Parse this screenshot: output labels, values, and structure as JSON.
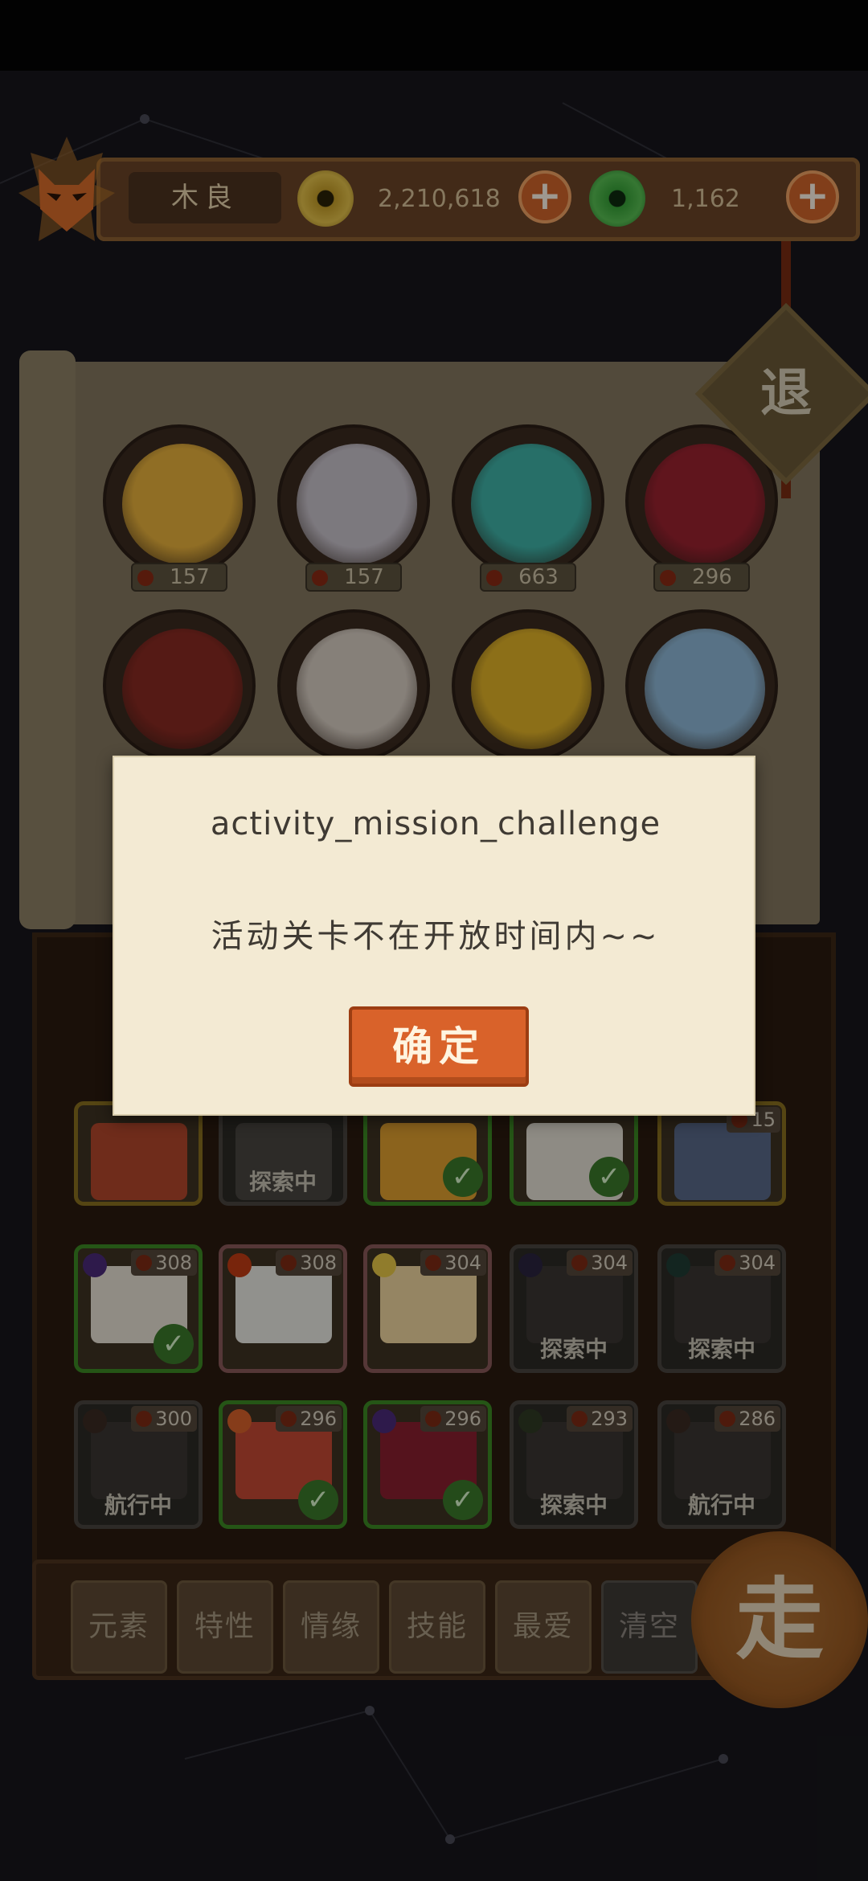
{
  "header": {
    "player_name": "木良",
    "gold_amount": "2,210,618",
    "jade_amount": "1,162",
    "plus_symbol": "+"
  },
  "retreat_label": "退",
  "portraits": [
    {
      "score": "157",
      "color": "#e9b23c"
    },
    {
      "score": "157",
      "color": "#c9c3cc"
    },
    {
      "score": "663",
      "color": "#3fb3a8"
    },
    {
      "score": "296",
      "color": "#9c2230"
    },
    {
      "score": "",
      "color": "#8a2a22"
    },
    {
      "score": "",
      "color": "#d9cfc4"
    },
    {
      "score": "",
      "color": "#e3b428"
    },
    {
      "score": "",
      "color": "#8fb9d8"
    }
  ],
  "cards": [
    {
      "pts": "",
      "status": "",
      "check": false,
      "style": "gold",
      "art": "#b4472c",
      "elem": ""
    },
    {
      "pts": "",
      "status": "探索中",
      "check": false,
      "style": "gray",
      "art": "#4a4642",
      "elem": ""
    },
    {
      "pts": "",
      "status": "",
      "check": true,
      "style": "green",
      "art": "#e0a030",
      "elem": ""
    },
    {
      "pts": "",
      "status": "",
      "check": true,
      "style": "green",
      "art": "#e6e1d6",
      "elem": ""
    },
    {
      "pts": "15",
      "status": "",
      "check": false,
      "style": "gold",
      "art": "#5a6a8a",
      "elem": ""
    },
    {
      "pts": "308",
      "status": "",
      "check": true,
      "style": "green",
      "art": "#e8e2d6",
      "elem": "#4b2a7a"
    },
    {
      "pts": "308",
      "status": "",
      "check": false,
      "style": "pink",
      "art": "#eaeae4",
      "elem": "#c23c14"
    },
    {
      "pts": "304",
      "status": "",
      "check": false,
      "style": "pink",
      "art": "#f0d7a0",
      "elem": "#e8c848"
    },
    {
      "pts": "304",
      "status": "探索中",
      "check": false,
      "style": "gray",
      "art": "#3a3632",
      "elem": "#2a2440"
    },
    {
      "pts": "304",
      "status": "探索中",
      "check": false,
      "style": "gray",
      "art": "#3a3632",
      "elem": "#203c34"
    },
    {
      "pts": "300",
      "status": "航行中",
      "check": false,
      "style": "gray",
      "art": "#3a3632",
      "elem": "#3a2a22"
    },
    {
      "pts": "296",
      "status": "",
      "check": true,
      "style": "green",
      "art": "#c54a34",
      "elem": "#d9622a"
    },
    {
      "pts": "296",
      "status": "",
      "check": true,
      "style": "green",
      "art": "#8a2030",
      "elem": "#4b2a7a"
    },
    {
      "pts": "293",
      "status": "探索中",
      "check": false,
      "style": "gray",
      "art": "#3a3632",
      "elem": "#2f3a24"
    },
    {
      "pts": "286",
      "status": "航行中",
      "check": false,
      "style": "gray",
      "art": "#3a3632",
      "elem": "#3a2a22"
    }
  ],
  "tabs": [
    "元素",
    "特性",
    "情缘",
    "技能",
    "最爱",
    "清空"
  ],
  "go_label": "走",
  "dialog": {
    "title": "activity_mission_challenge",
    "message": "活动关卡不在开放时间内~~",
    "confirm_label": "确定"
  },
  "colors": {
    "accent_orange": "#d9622a",
    "dialog_bg": "#f3ead3",
    "explore_green": "#3c8a24"
  }
}
